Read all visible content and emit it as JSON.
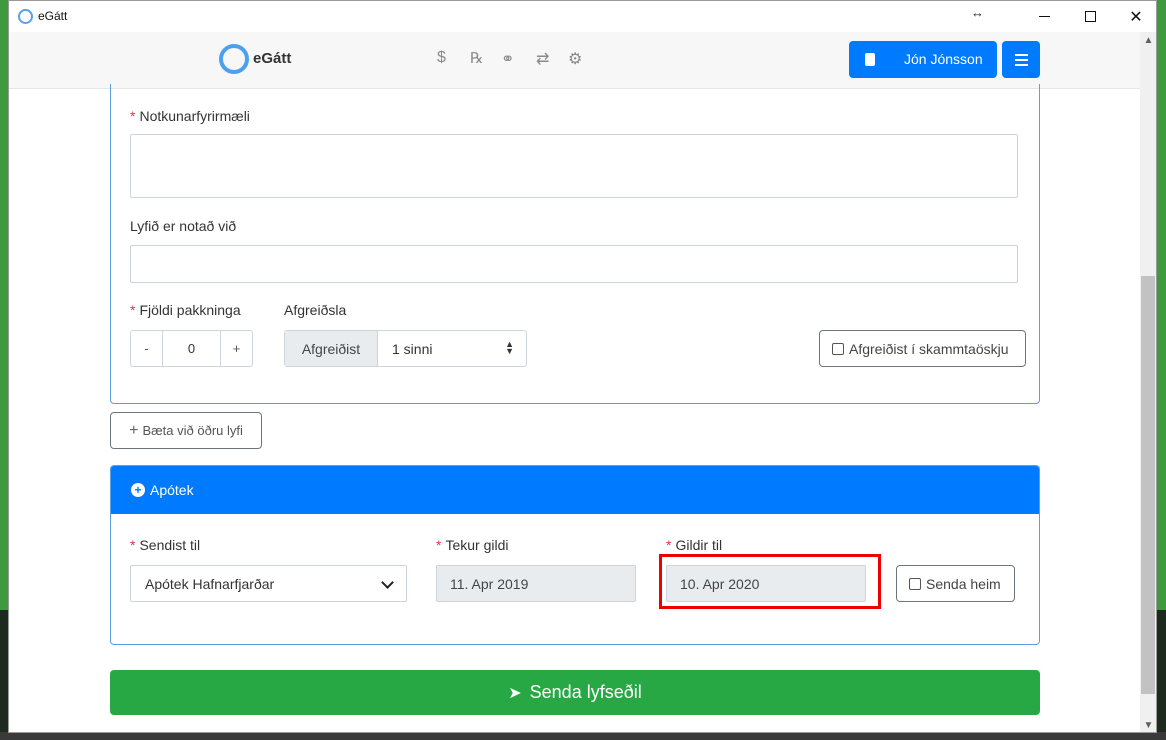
{
  "window": {
    "title": "eGátt",
    "resize_glyph": "↔",
    "close_glyph": "✕"
  },
  "navbar": {
    "logo_text": "eGátt",
    "icons": [
      "dollar-icon",
      "rx-icon",
      "pills-icon",
      "transfer-icon",
      "settings-icon"
    ],
    "icon_glyphs": {
      "dollar": "$",
      "rx": "℞",
      "pills": "⚭",
      "transfer": "⇄",
      "settings": "⚙"
    },
    "user_name": "Jón Jónsson"
  },
  "prescription": {
    "notkun_label": "Notkunarfyrirmæli",
    "notad_label": "Lyfið er notað við",
    "fjoldi_label": "Fjöldi pakkninga",
    "required_mark": "*",
    "stepper": {
      "minus": "-",
      "value": "0",
      "plus": "+"
    },
    "afgreidsla_label": "Afgreiðsla",
    "afgreidsla_prefix": "Afgreiðist",
    "afgreidsla_value": "1 sinni",
    "skammt_label": "Afgreiðist í skammtaöskju",
    "add_drug_label": "Bæta við öðru lyfi"
  },
  "apotek": {
    "title": "Apótek",
    "sendist_label": "Sendist til",
    "sendist_value": "Apótek Hafnarfjarðar",
    "tekur_label": "Tekur gildi",
    "tekur_value": "11. Apr 2019",
    "gildir_label": "Gildir til",
    "gildir_value": "10. Apr 2020",
    "senda_heim_label": "Senda heim"
  },
  "submit_label": "Senda lyfseðil",
  "colors": {
    "primary": "#007bff",
    "success": "#28a745",
    "required": "#dc3545",
    "highlight": "#ee0000"
  }
}
